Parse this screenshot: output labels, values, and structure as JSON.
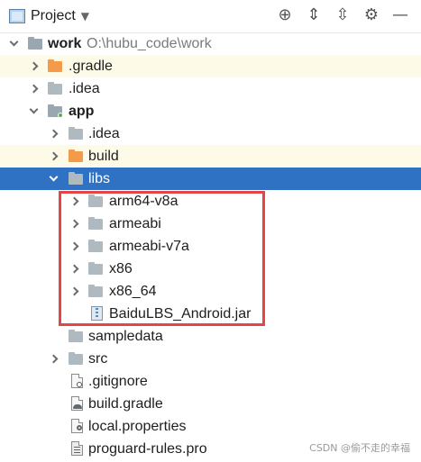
{
  "header": {
    "title": "Project",
    "view_icon": "project-view-icon",
    "dropdown_icon": "chevron-down-icon",
    "tools": [
      {
        "name": "locate-icon",
        "glyph": "⊕"
      },
      {
        "name": "expand-all-icon",
        "glyph": "⇕"
      },
      {
        "name": "collapse-all-icon",
        "glyph": "⇳"
      },
      {
        "name": "settings-icon",
        "glyph": "⚙"
      },
      {
        "name": "hide-icon",
        "glyph": "—"
      }
    ]
  },
  "tree": [
    {
      "label": "work",
      "path": "O:\\hubu_code\\work",
      "bold": true,
      "expanded": true,
      "icon": "module-folder-icon"
    },
    {
      "label": ".gradle",
      "highlighted": true,
      "expanded": false,
      "icon": "orange-folder-icon"
    },
    {
      "label": ".idea",
      "expanded": false,
      "icon": "gray-folder-icon"
    },
    {
      "label": "app",
      "bold": true,
      "expanded": true,
      "icon": "module-folder-icon"
    },
    {
      "label": ".idea",
      "expanded": false,
      "icon": "gray-folder-icon"
    },
    {
      "label": "build",
      "highlighted": true,
      "expanded": false,
      "icon": "orange-folder-icon"
    },
    {
      "label": "libs",
      "selected": true,
      "expanded": true,
      "icon": "gray-folder-icon"
    },
    {
      "label": "arm64-v8a",
      "expanded": false,
      "icon": "gray-folder-icon"
    },
    {
      "label": "armeabi",
      "expanded": false,
      "icon": "gray-folder-icon"
    },
    {
      "label": "armeabi-v7a",
      "expanded": false,
      "icon": "gray-folder-icon"
    },
    {
      "label": "x86",
      "expanded": false,
      "icon": "gray-folder-icon"
    },
    {
      "label": "x86_64",
      "expanded": false,
      "icon": "gray-folder-icon"
    },
    {
      "label": "BaiduLBS_Android.jar",
      "icon": "jar-icon"
    },
    {
      "label": "sampledata",
      "icon": "gray-folder-icon"
    },
    {
      "label": "src",
      "expanded": false,
      "icon": "gray-folder-icon"
    },
    {
      "label": ".gitignore",
      "icon": "gitignore-icon"
    },
    {
      "label": "build.gradle",
      "icon": "gradle-icon"
    },
    {
      "label": "local.properties",
      "icon": "properties-icon"
    },
    {
      "label": "proguard-rules.pro",
      "icon": "proguard-icon"
    }
  ],
  "watermark": "CSDN @偷不走的幸福",
  "colors": {
    "selection": "#2f72c4",
    "highlight_row": "#fdfbe8",
    "red_box": "#e54545"
  }
}
